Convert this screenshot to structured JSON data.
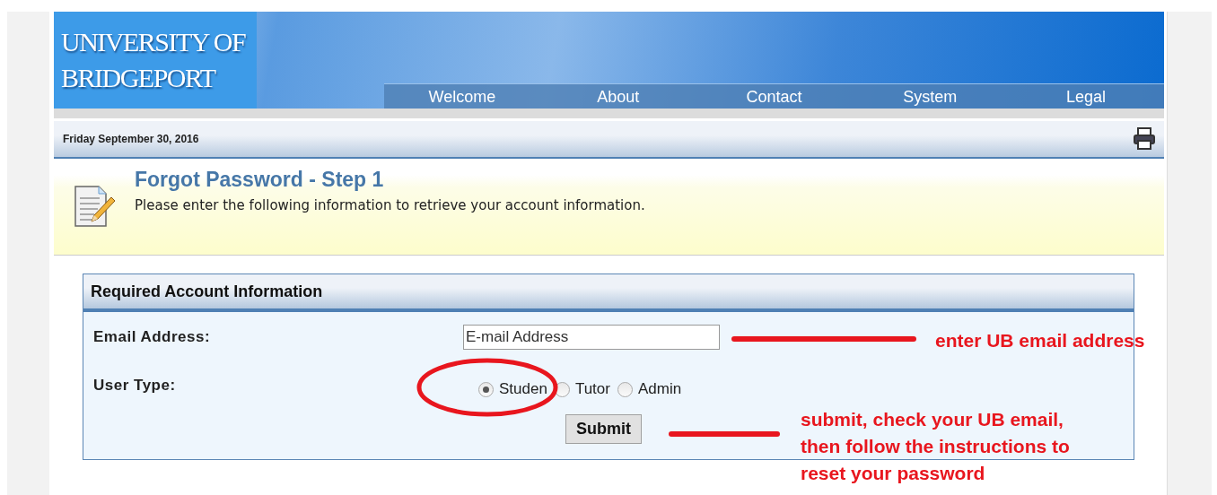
{
  "logo": {
    "lines": [
      "UNIVERSITY OF",
      "BRIDGEPORT"
    ]
  },
  "nav": [
    {
      "label": "Welcome"
    },
    {
      "label": "About"
    },
    {
      "label": "Contact"
    },
    {
      "label": "System"
    },
    {
      "label": "Legal"
    }
  ],
  "date": "Friday September 30, 2016",
  "intro": {
    "title": "Forgot Password - Step 1",
    "text": "Please enter the following information to retrieve your account information."
  },
  "panel": {
    "title": "Required Account Information",
    "fields": [
      {
        "kind": "text",
        "label": "Email Address:",
        "placeholder": "E-mail Address"
      },
      {
        "kind": "radio",
        "label": "User Type:",
        "options": [
          {
            "label": "Studen",
            "selected": true
          },
          {
            "label": "Tutor",
            "selected": false
          },
          {
            "label": "Admin",
            "selected": false
          }
        ]
      }
    ],
    "submit": "Submit"
  },
  "annotations": [
    {
      "kind": "line-note",
      "text": "enter UB email address"
    },
    {
      "kind": "line-note",
      "text": "submit, check your UB email, then follow the instructions to reset your password"
    },
    {
      "kind": "ellipse"
    }
  ]
}
